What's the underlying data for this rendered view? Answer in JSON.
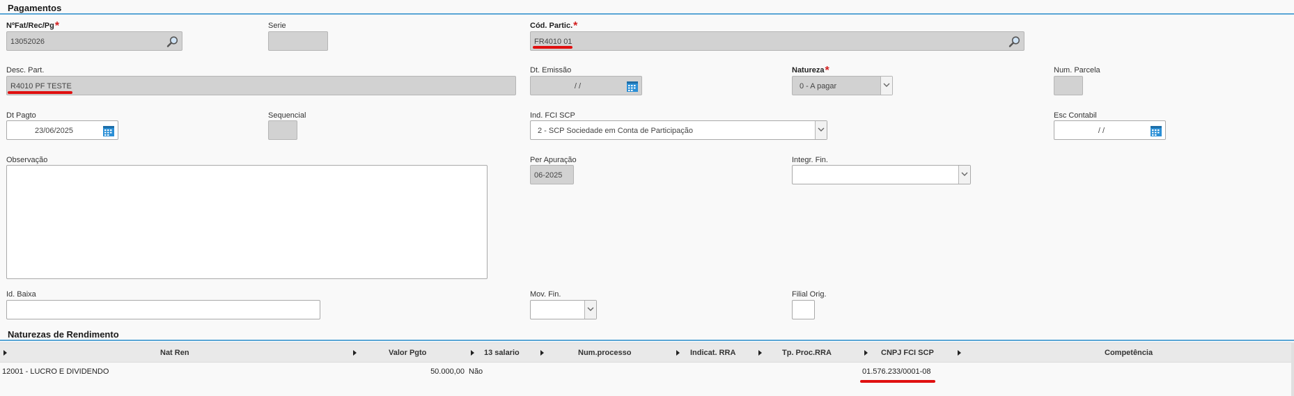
{
  "pagamentos": {
    "title": "Pagamentos",
    "nfat": {
      "label": "NºFat/Rec/Pg",
      "value": "13052026"
    },
    "serie": {
      "label": "Serie",
      "value": ""
    },
    "cod_partic": {
      "label": "Cód. Partic.",
      "value": "FR4010 01"
    },
    "desc_part": {
      "label": "Desc. Part.",
      "value": "R4010 PF TESTE"
    },
    "dt_emissao": {
      "label": "Dt. Emissão",
      "value": "/ /"
    },
    "natureza": {
      "label": "Natureza",
      "value": "0 - A pagar"
    },
    "num_parcela": {
      "label": "Num. Parcela",
      "value": ""
    },
    "dt_pagto": {
      "label": "Dt Pagto",
      "value": "23/06/2025"
    },
    "sequencial": {
      "label": "Sequencial",
      "value": ""
    },
    "ind_fci_scp": {
      "label": "Ind. FCI SCP",
      "value": "2 - SCP Sociedade em Conta de Participação"
    },
    "esc_contabil": {
      "label": "Esc Contabil",
      "value": "/ /"
    },
    "observacao": {
      "label": "Observação",
      "value": ""
    },
    "per_apuracao": {
      "label": "Per Apuração",
      "value": "06-2025"
    },
    "integr_fin": {
      "label": "Integr. Fin.",
      "value": ""
    },
    "id_baixa": {
      "label": "Id. Baixa",
      "value": ""
    },
    "mov_fin": {
      "label": "Mov. Fin.",
      "value": ""
    },
    "filial_orig": {
      "label": "Filial Orig.",
      "value": ""
    }
  },
  "naturezas": {
    "title": "Naturezas de Rendimento",
    "columns": [
      "Nat Ren",
      "Valor Pgto",
      "13 salario",
      "Num.processo",
      "Indicat. RRA",
      "Tp. Proc.RRA",
      "CNPJ FCI SCP",
      "Competência"
    ],
    "rows": [
      {
        "nat_ren": "12001 - LUCRO E DIVIDENDO",
        "valor": "50.000,00",
        "decimo": "Não",
        "num_processo": "",
        "indicat_rra": "",
        "tp_proc_rra": "",
        "cnpj": "01.576.233/0001-08",
        "competencia": ""
      }
    ]
  },
  "colors": {
    "accent": "#5aa6d6",
    "required": "#d32020",
    "highlight": "#e01010"
  },
  "icons": [
    "search-icon",
    "calendar-icon",
    "chevron-down-icon",
    "column-arrow-icon"
  ]
}
